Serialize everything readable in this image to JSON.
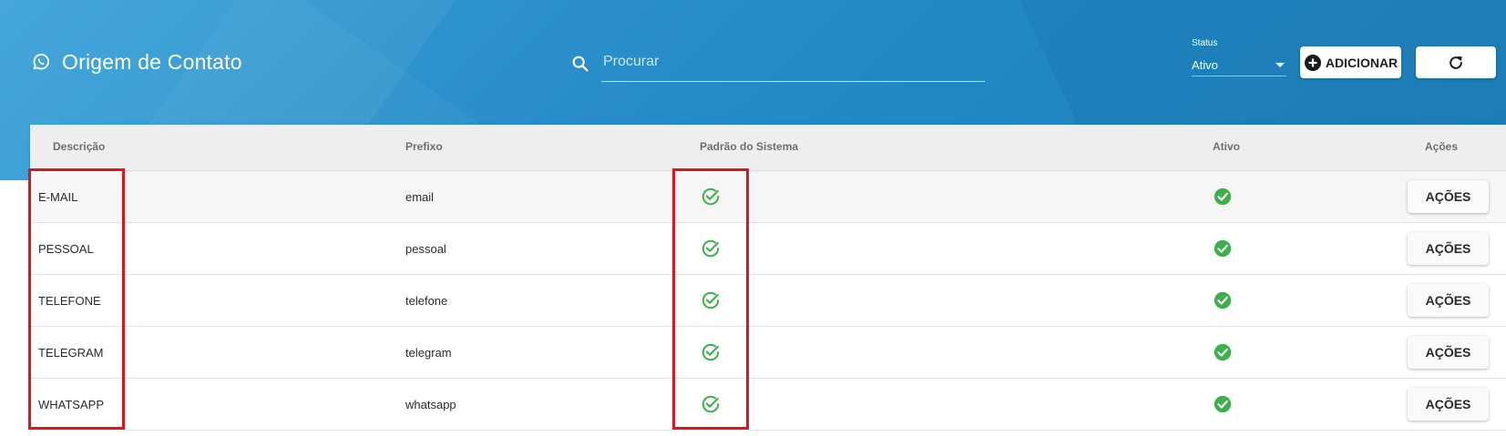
{
  "header": {
    "title": "Origem de Contato",
    "title_icon": "whatsapp-icon",
    "search": {
      "placeholder": "Procurar",
      "icon": "search-icon"
    },
    "status_filter": {
      "label": "Status",
      "value": "Ativo"
    },
    "add_button": {
      "label": "ADICIONAR",
      "icon": "plus-circle-icon"
    },
    "refresh_button": {
      "icon": "refresh-icon"
    }
  },
  "table": {
    "columns": [
      "Descrição",
      "Prefixo",
      "Padrão do Sistema",
      "Ativo",
      "Ações"
    ],
    "rows": [
      {
        "descricao": "E-MAIL",
        "prefixo": "email",
        "padrao": true,
        "ativo": true,
        "acoes_label": "AÇÕES"
      },
      {
        "descricao": "PESSOAL",
        "prefixo": "pessoal",
        "padrao": true,
        "ativo": true,
        "acoes_label": "AÇÕES"
      },
      {
        "descricao": "TELEFONE",
        "prefixo": "telefone",
        "padrao": true,
        "ativo": true,
        "acoes_label": "AÇÕES"
      },
      {
        "descricao": "TELEGRAM",
        "prefixo": "telegram",
        "padrao": true,
        "ativo": true,
        "acoes_label": "AÇÕES"
      },
      {
        "descricao": "WHATSAPP",
        "prefixo": "whatsapp",
        "padrao": true,
        "ativo": true,
        "acoes_label": "AÇÕES"
      }
    ]
  },
  "colors": {
    "header_blue": "#2188c4",
    "check_green": "#3cb04a",
    "highlight_red": "#e0141b"
  }
}
